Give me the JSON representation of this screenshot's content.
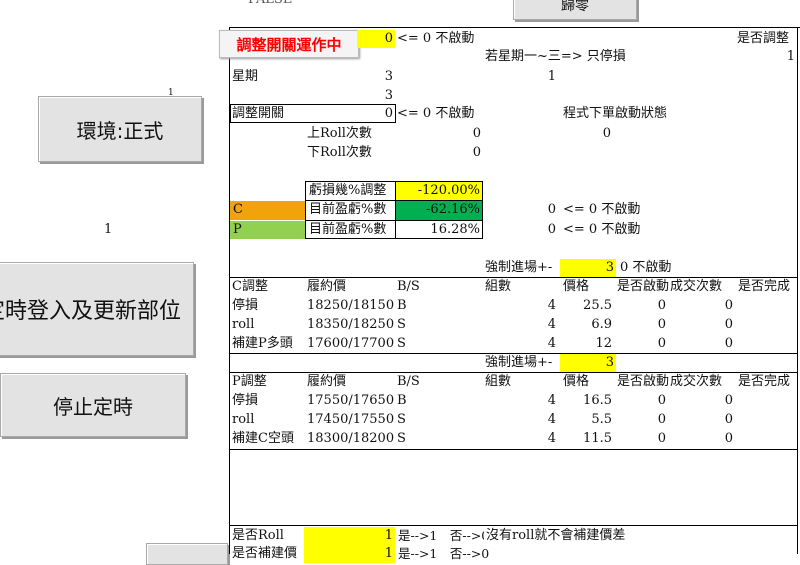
{
  "top": {
    "false_text": "FALSE",
    "top_button_label": "歸零"
  },
  "status_label": "調整開關運作中",
  "left": {
    "env_button": "環境:正式",
    "timer_login_button": "定時登入及更新部位",
    "stop_timer_button": "停止定時",
    "num_1a": "1",
    "num_1b": "1"
  },
  "settings": {
    "switch_value": "0",
    "switch_note": "<= 0 不啟動",
    "is_adjust_label": "是否調整",
    "is_adjust_value": "1",
    "weekday_note": "若星期一~三=> 只停損",
    "weekday_label": "星期",
    "weekday_value": "3",
    "weekday_flag": "1",
    "weekday_value2": "3",
    "adjust_switch_label": "調整開關",
    "adjust_switch_value": "0",
    "adjust_switch_note": "<= 0 不啟動",
    "program_order_label": "程式下單啟動狀態",
    "program_order_value": "0",
    "up_roll_label": "上Roll次數",
    "up_roll_value": "0",
    "down_roll_label": "下Roll次數",
    "down_roll_value": "0",
    "loss_pct_label": "虧損幾%調整",
    "loss_pct_value": "-120.00%",
    "c_label": "C",
    "c_pnl_label": "目前盈虧%數",
    "c_pnl_value": "-62.16%",
    "c_flag": "0",
    "c_note": "<= 0 不啟動",
    "p_label": "P",
    "p_pnl_label": "目前盈虧%數",
    "p_pnl_value": "16.28%",
    "p_flag": "0",
    "p_note": "<= 0 不啟動"
  },
  "force_c": {
    "label": "強制進場+-",
    "value": "3",
    "note": "0 不啟動"
  },
  "force_p": {
    "label": "強制進場+-",
    "value": "3"
  },
  "table_headers": [
    "履約價",
    "B/S",
    "組數",
    "價格",
    "是否啟動",
    "成交次數",
    "是否完成"
  ],
  "c_table": {
    "title": "C調整",
    "rows": [
      {
        "name": "停損",
        "strike": "18250/18150",
        "bs": "B",
        "qty": "4",
        "price": "25.5",
        "start": "0",
        "count": "0"
      },
      {
        "name": "roll",
        "strike": "18350/18250",
        "bs": "S",
        "qty": "4",
        "price": "6.9",
        "start": "0",
        "count": "0"
      },
      {
        "name": "補建P多頭",
        "strike": "17600/17700",
        "bs": "S",
        "qty": "4",
        "price": "12",
        "start": "0",
        "count": "0"
      }
    ]
  },
  "p_table": {
    "title": "P調整",
    "rows": [
      {
        "name": "停損",
        "strike": "17550/17650",
        "bs": "B",
        "qty": "4",
        "price": "16.5",
        "start": "0",
        "count": "0"
      },
      {
        "name": "roll",
        "strike": "17450/17550",
        "bs": "S",
        "qty": "4",
        "price": "5.5",
        "start": "0",
        "count": "0"
      },
      {
        "name": "補建C空頭",
        "strike": "18300/18200",
        "bs": "S",
        "qty": "4",
        "price": "11.5",
        "start": "0",
        "count": "0"
      }
    ]
  },
  "bottom": {
    "roll_label": "是否Roll",
    "roll_value": "1",
    "roll_note": "是-->1　否-->0",
    "roll_hint": "沒有roll就不會補建價差",
    "rebuild_label": "是否補建價",
    "rebuild_value": "1",
    "rebuild_note": "是-->1　否-->0"
  },
  "colors": {
    "yellow": "#ffff00",
    "orange": "#f0a30a",
    "green_light": "#92d050",
    "green_dark": "#00b050",
    "status_red": "#ff0000"
  }
}
